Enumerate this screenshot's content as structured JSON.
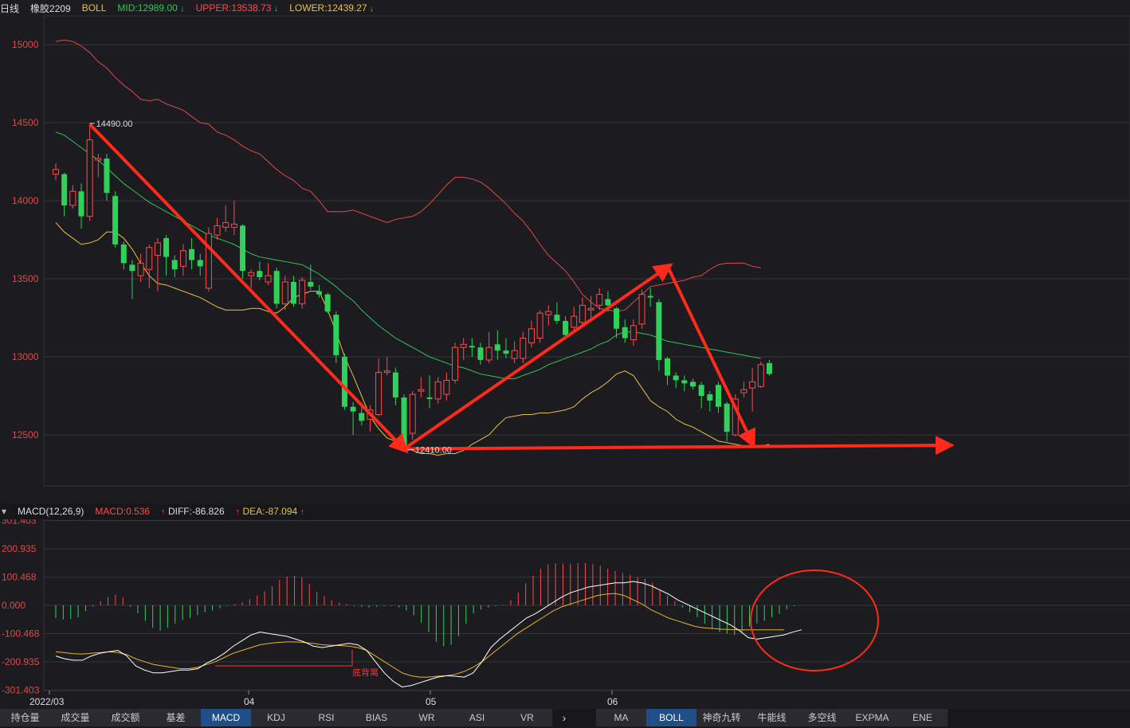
{
  "main_header": {
    "period": "日线",
    "symbol": "橡胶2209",
    "indicator": "BOLL",
    "mid": "MID:12989.00",
    "upper": "UPPER:13538.73",
    "lower": "LOWER:12439.27"
  },
  "macd_header": {
    "title": "MACD(12,26,9)",
    "macd": "MACD:0.536",
    "diff": "DIFF:-86.826",
    "dea": "DEA:-87.094"
  },
  "annotations": {
    "high_label": "14490.00",
    "low_label": "12410.00",
    "divergence_label": "底背离"
  },
  "indicator_tabs": [
    "持仓量",
    "成交量",
    "成交额",
    "基差",
    "MACD",
    "KDJ",
    "RSI",
    "BIAS",
    "WR",
    "ASI",
    "VR"
  ],
  "active_indicator_tab": "MACD",
  "overlay_tabs": [
    "MA",
    "BOLL",
    "神奇九转",
    "牛能线",
    "多空线",
    "EXPMA",
    "ENE"
  ],
  "active_overlay_tab": "BOLL",
  "colors": {
    "up": "#ff4a4a",
    "down": "#2fd15a",
    "mid": "#2fc45a",
    "upper": "#e04848",
    "lower": "#e8c14a",
    "diff": "#ffffff",
    "dea": "#e8b528",
    "annot": "#ff2a1a"
  },
  "chart_data": [
    {
      "type": "candlestick",
      "title": "橡胶2209 日线 BOLL",
      "x_ticks": [
        {
          "i": 0,
          "label": "2022/03"
        },
        {
          "i": 18,
          "label": "04"
        },
        {
          "i": 38,
          "label": "05"
        },
        {
          "i": 58,
          "label": "06"
        }
      ],
      "y_ticks": [
        12500,
        13000,
        13500,
        14000,
        14500,
        15000
      ],
      "ylim": [
        12200,
        15200
      ],
      "candles": [
        {
          "o": 14170,
          "c": 14200,
          "h": 14240,
          "l": 14130
        },
        {
          "o": 14170,
          "c": 13970,
          "h": 14180,
          "l": 13900
        },
        {
          "o": 13970,
          "c": 14060,
          "h": 14100,
          "l": 13950
        },
        {
          "o": 14060,
          "c": 13900,
          "h": 14110,
          "l": 13820
        },
        {
          "o": 13900,
          "c": 14390,
          "h": 14490,
          "l": 13870
        },
        {
          "o": 14260,
          "c": 14270,
          "h": 14300,
          "l": 14150
        },
        {
          "o": 14270,
          "c": 14050,
          "h": 14300,
          "l": 14000
        },
        {
          "o": 14030,
          "c": 13720,
          "h": 14060,
          "l": 13700
        },
        {
          "o": 13720,
          "c": 13600,
          "h": 13740,
          "l": 13560
        },
        {
          "o": 13590,
          "c": 13550,
          "h": 13620,
          "l": 13370
        },
        {
          "o": 13520,
          "c": 13600,
          "h": 13660,
          "l": 13480
        },
        {
          "o": 13560,
          "c": 13700,
          "h": 13720,
          "l": 13440
        },
        {
          "o": 13650,
          "c": 13730,
          "h": 13760,
          "l": 13420
        },
        {
          "o": 13760,
          "c": 13640,
          "h": 13780,
          "l": 13520
        },
        {
          "o": 13620,
          "c": 13560,
          "h": 13650,
          "l": 13510
        },
        {
          "o": 13580,
          "c": 13680,
          "h": 13720,
          "l": 13520
        },
        {
          "o": 13690,
          "c": 13620,
          "h": 13760,
          "l": 13560
        },
        {
          "o": 13620,
          "c": 13580,
          "h": 13660,
          "l": 13520
        },
        {
          "o": 13440,
          "c": 13790,
          "h": 13830,
          "l": 13420
        },
        {
          "o": 13780,
          "c": 13840,
          "h": 13890,
          "l": 13750
        },
        {
          "o": 13830,
          "c": 13860,
          "h": 13970,
          "l": 13800
        },
        {
          "o": 13830,
          "c": 13850,
          "h": 14000,
          "l": 13780
        },
        {
          "o": 13840,
          "c": 13550,
          "h": 13850,
          "l": 13500
        },
        {
          "o": 13520,
          "c": 13540,
          "h": 13560,
          "l": 13440
        },
        {
          "o": 13550,
          "c": 13510,
          "h": 13610,
          "l": 13490
        },
        {
          "o": 13480,
          "c": 13520,
          "h": 13600,
          "l": 13460
        },
        {
          "o": 13550,
          "c": 13340,
          "h": 13570,
          "l": 13310
        },
        {
          "o": 13340,
          "c": 13480,
          "h": 13520,
          "l": 13300
        },
        {
          "o": 13480,
          "c": 13340,
          "h": 13520,
          "l": 13320
        },
        {
          "o": 13340,
          "c": 13490,
          "h": 13510,
          "l": 13310
        },
        {
          "o": 13480,
          "c": 13450,
          "h": 13590,
          "l": 13430
        },
        {
          "o": 13420,
          "c": 13400,
          "h": 13460,
          "l": 13380
        },
        {
          "o": 13400,
          "c": 13290,
          "h": 13410,
          "l": 13280
        },
        {
          "o": 13270,
          "c": 13010,
          "h": 13290,
          "l": 12960
        },
        {
          "o": 13000,
          "c": 12680,
          "h": 13020,
          "l": 12660
        },
        {
          "o": 12680,
          "c": 12650,
          "h": 12710,
          "l": 12500
        },
        {
          "o": 12640,
          "c": 12590,
          "h": 12690,
          "l": 12560
        },
        {
          "o": 12600,
          "c": 12660,
          "h": 12690,
          "l": 12520
        },
        {
          "o": 12630,
          "c": 12900,
          "h": 12990,
          "l": 12620
        },
        {
          "o": 12900,
          "c": 12910,
          "h": 13000,
          "l": 12880
        },
        {
          "o": 12900,
          "c": 12740,
          "h": 12930,
          "l": 12690
        },
        {
          "o": 12740,
          "c": 12420,
          "h": 12760,
          "l": 12410
        },
        {
          "o": 12510,
          "c": 12760,
          "h": 12780,
          "l": 12470
        },
        {
          "o": 12780,
          "c": 12790,
          "h": 12870,
          "l": 12740
        },
        {
          "o": 12740,
          "c": 12730,
          "h": 12880,
          "l": 12670
        },
        {
          "o": 12730,
          "c": 12840,
          "h": 12870,
          "l": 12700
        },
        {
          "o": 12760,
          "c": 12850,
          "h": 12900,
          "l": 12720
        },
        {
          "o": 12850,
          "c": 13060,
          "h": 13090,
          "l": 12830
        },
        {
          "o": 13060,
          "c": 13080,
          "h": 13120,
          "l": 12980
        },
        {
          "o": 13070,
          "c": 13060,
          "h": 13120,
          "l": 13000
        },
        {
          "o": 13060,
          "c": 12980,
          "h": 13090,
          "l": 12950
        },
        {
          "o": 12980,
          "c": 13060,
          "h": 13160,
          "l": 12960
        },
        {
          "o": 13080,
          "c": 13040,
          "h": 13170,
          "l": 12980
        },
        {
          "o": 13040,
          "c": 13020,
          "h": 13120,
          "l": 12990
        },
        {
          "o": 12990,
          "c": 13040,
          "h": 13100,
          "l": 12960
        },
        {
          "o": 12990,
          "c": 13120,
          "h": 13160,
          "l": 12960
        },
        {
          "o": 13090,
          "c": 13180,
          "h": 13230,
          "l": 13060
        },
        {
          "o": 13120,
          "c": 13280,
          "h": 13300,
          "l": 13090
        },
        {
          "o": 13270,
          "c": 13290,
          "h": 13330,
          "l": 13200
        },
        {
          "o": 13270,
          "c": 13230,
          "h": 13350,
          "l": 13210
        },
        {
          "o": 13230,
          "c": 13140,
          "h": 13260,
          "l": 13110
        },
        {
          "o": 13190,
          "c": 13260,
          "h": 13320,
          "l": 13160
        },
        {
          "o": 13220,
          "c": 13330,
          "h": 13380,
          "l": 13200
        },
        {
          "o": 13300,
          "c": 13310,
          "h": 13390,
          "l": 13250
        },
        {
          "o": 13330,
          "c": 13400,
          "h": 13440,
          "l": 13300
        },
        {
          "o": 13370,
          "c": 13330,
          "h": 13420,
          "l": 13290
        },
        {
          "o": 13310,
          "c": 13180,
          "h": 13320,
          "l": 13120
        },
        {
          "o": 13190,
          "c": 13120,
          "h": 13240,
          "l": 13090
        },
        {
          "o": 13110,
          "c": 13200,
          "h": 13240,
          "l": 13070
        },
        {
          "o": 13210,
          "c": 13400,
          "h": 13430,
          "l": 13180
        },
        {
          "o": 13390,
          "c": 13380,
          "h": 13440,
          "l": 13320
        },
        {
          "o": 13350,
          "c": 12980,
          "h": 13370,
          "l": 12910
        },
        {
          "o": 12990,
          "c": 12880,
          "h": 13000,
          "l": 12820
        },
        {
          "o": 12880,
          "c": 12850,
          "h": 12900,
          "l": 12800
        },
        {
          "o": 12850,
          "c": 12830,
          "h": 12880,
          "l": 12780
        },
        {
          "o": 12840,
          "c": 12810,
          "h": 12860,
          "l": 12790
        },
        {
          "o": 12820,
          "c": 12750,
          "h": 12840,
          "l": 12670
        },
        {
          "o": 12760,
          "c": 12720,
          "h": 12780,
          "l": 12650
        },
        {
          "o": 12820,
          "c": 12680,
          "h": 12840,
          "l": 12640
        },
        {
          "o": 12700,
          "c": 12520,
          "h": 12710,
          "l": 12460
        },
        {
          "o": 12500,
          "c": 12730,
          "h": 12760,
          "l": 12490
        },
        {
          "o": 12770,
          "c": 12790,
          "h": 12840,
          "l": 12740
        },
        {
          "o": 12800,
          "c": 12840,
          "h": 12930,
          "l": 12650
        },
        {
          "o": 12810,
          "c": 12950,
          "h": 12970,
          "l": 12800
        },
        {
          "o": 12960,
          "c": 12890,
          "h": 12980,
          "l": 12880
        }
      ],
      "boll_mid": [
        14440,
        14420,
        14380,
        14340,
        14300,
        14260,
        14210,
        14160,
        14110,
        14070,
        14030,
        13990,
        13960,
        13930,
        13900,
        13870,
        13840,
        13810,
        13780,
        13760,
        13740,
        13720,
        13690,
        13660,
        13640,
        13630,
        13620,
        13610,
        13600,
        13590,
        13560,
        13530,
        13490,
        13450,
        13400,
        13360,
        13300,
        13250,
        13200,
        13160,
        13120,
        13090,
        13060,
        13030,
        13000,
        12980,
        12960,
        12940,
        12930,
        12910,
        12890,
        12880,
        12870,
        12860,
        12860,
        12880,
        12900,
        12920,
        12950,
        12970,
        12990,
        13010,
        13030,
        13050,
        13080,
        13100,
        13140,
        13160,
        13160,
        13150,
        13140,
        13120,
        13100,
        13090,
        13080,
        13070,
        13060,
        13050,
        13040,
        13030,
        13020,
        13010,
        13000,
        12990
      ],
      "boll_upper": [
        15020,
        15030,
        15020,
        14990,
        14950,
        14890,
        14850,
        14790,
        14740,
        14700,
        14650,
        14640,
        14650,
        14620,
        14600,
        14580,
        14540,
        14500,
        14490,
        14440,
        14420,
        14390,
        14350,
        14320,
        14300,
        14250,
        14200,
        14160,
        14130,
        14080,
        14060,
        14000,
        13930,
        13930,
        13930,
        13940,
        13920,
        13900,
        13880,
        13860,
        13880,
        13890,
        13900,
        13930,
        13980,
        14040,
        14100,
        14150,
        14150,
        14140,
        14120,
        14080,
        14030,
        13980,
        13920,
        13870,
        13800,
        13720,
        13650,
        13600,
        13550,
        13480,
        13400,
        13350,
        13310,
        13300,
        13290,
        13300,
        13350,
        13400,
        13450,
        13460,
        13470,
        13480,
        13490,
        13510,
        13520,
        13560,
        13590,
        13600,
        13600,
        13600,
        13580,
        13570
      ],
      "boll_lower": [
        13860,
        13800,
        13760,
        13720,
        13730,
        13750,
        13800,
        13800,
        13760,
        13690,
        13600,
        13520,
        13470,
        13460,
        13440,
        13420,
        13400,
        13380,
        13350,
        13320,
        13300,
        13300,
        13300,
        13310,
        13310,
        13290,
        13280,
        13320,
        13380,
        13400,
        13420,
        13420,
        13300,
        13160,
        13000,
        12880,
        12750,
        12620,
        12540,
        12480,
        12460,
        12430,
        12400,
        12380,
        12380,
        12370,
        12380,
        12380,
        12400,
        12440,
        12470,
        12500,
        12560,
        12610,
        12620,
        12630,
        12630,
        12640,
        12640,
        12650,
        12660,
        12680,
        12730,
        12770,
        12800,
        12840,
        12890,
        12910,
        12880,
        12800,
        12720,
        12680,
        12650,
        12600,
        12570,
        12550,
        12520,
        12490,
        12460,
        12450,
        12440,
        12430,
        12430,
        12430,
        12439.27
      ]
    },
    {
      "type": "macd",
      "title": "MACD(12,26,9)",
      "y_ticks": [
        301.403,
        200.935,
        100.468,
        0.0,
        -100.468,
        -200.935,
        -301.403
      ],
      "ylim": [
        -301.403,
        301.403
      ],
      "histogram": [
        -45,
        -50,
        -48,
        -42,
        -20,
        -5,
        15,
        30,
        38,
        28,
        -5,
        -28,
        -55,
        -80,
        -90,
        -80,
        -65,
        -52,
        -45,
        -35,
        -25,
        -18,
        -10,
        -2,
        5,
        12,
        22,
        35,
        50,
        68,
        90,
        102,
        105,
        100,
        75,
        48,
        32,
        18,
        10,
        5,
        -2,
        -5,
        -8,
        -5,
        -3,
        -2,
        -8,
        -18,
        -35,
        -62,
        -95,
        -130,
        -145,
        -140,
        -110,
        -65,
        -28,
        -15,
        -8,
        -3,
        2,
        18,
        45,
        78,
        105,
        130,
        145,
        150,
        148,
        148,
        150,
        150,
        146,
        140,
        130,
        122,
        115,
        108,
        100,
        95,
        80,
        55,
        35,
        15,
        -8,
        -25,
        -42,
        -65,
        -85,
        -95,
        -100,
        -105,
        -95,
        -75,
        -65,
        -55,
        -42,
        -30,
        -15,
        -3,
        0.536
      ],
      "diff": [
        -180,
        -190,
        -195,
        -195,
        -180,
        -170,
        -165,
        -160,
        -180,
        -215,
        -230,
        -240,
        -240,
        -235,
        -230,
        -230,
        -225,
        -205,
        -190,
        -170,
        -145,
        -125,
        -105,
        -95,
        -100,
        -105,
        -110,
        -120,
        -130,
        -145,
        -150,
        -145,
        -140,
        -135,
        -140,
        -160,
        -200,
        -240,
        -270,
        -290,
        -285,
        -275,
        -265,
        -255,
        -250,
        -252,
        -255,
        -240,
        -200,
        -150,
        -120,
        -95,
        -70,
        -45,
        -30,
        -10,
        10,
        30,
        45,
        55,
        65,
        70,
        75,
        80,
        80,
        85,
        80,
        70,
        55,
        40,
        20,
        5,
        -10,
        -25,
        -40,
        -55,
        -70,
        -90,
        -115,
        -120,
        -115,
        -110,
        -105,
        -95,
        -86.826
      ],
      "dea": [
        -165,
        -168,
        -172,
        -173,
        -170,
        -168,
        -165,
        -168,
        -175,
        -190,
        -200,
        -210,
        -215,
        -220,
        -225,
        -225,
        -220,
        -210,
        -200,
        -185,
        -170,
        -160,
        -150,
        -140,
        -135,
        -132,
        -130,
        -130,
        -132,
        -135,
        -140,
        -142,
        -143,
        -145,
        -150,
        -160,
        -180,
        -200,
        -220,
        -240,
        -250,
        -255,
        -255,
        -252,
        -250,
        -245,
        -235,
        -220,
        -200,
        -175,
        -150,
        -125,
        -100,
        -80,
        -60,
        -40,
        -20,
        -5,
        5,
        15,
        25,
        35,
        40,
        42,
        35,
        20,
        5,
        -15,
        -30,
        -45,
        -55,
        -65,
        -75,
        -80,
        -82,
        -85,
        -86,
        -87,
        -87,
        -87,
        -87,
        -87,
        -87.094
      ]
    }
  ]
}
